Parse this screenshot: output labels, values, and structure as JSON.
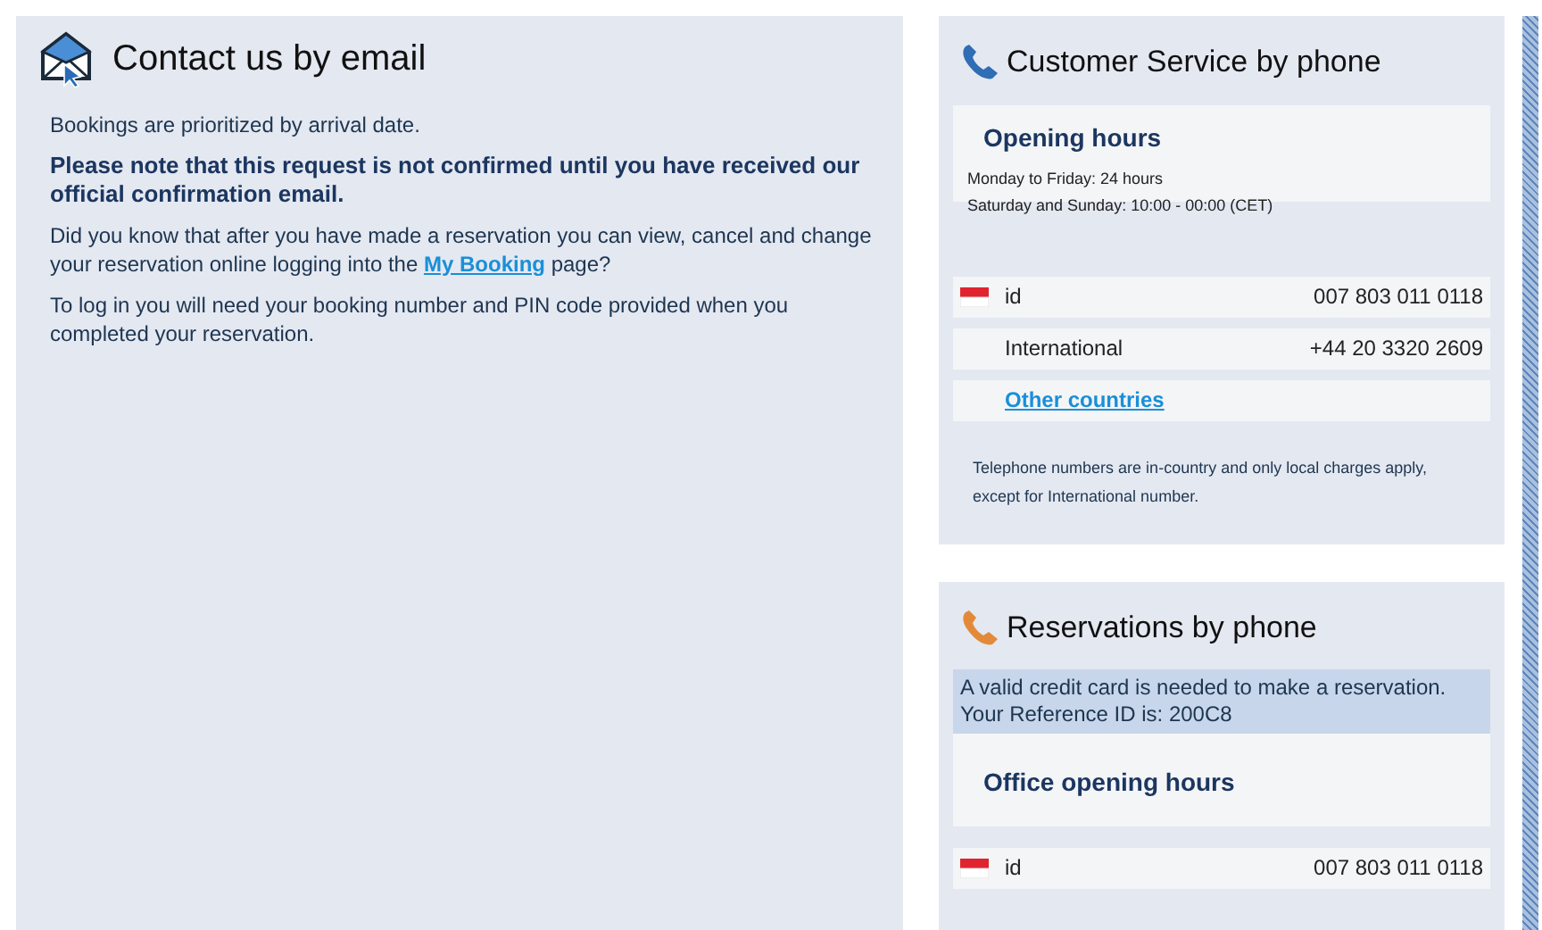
{
  "email": {
    "title": "Contact us by email",
    "paragraphs": [
      {
        "kind": "plain",
        "text": "Bookings are prioritized by arrival date."
      },
      {
        "kind": "note",
        "text": "Please note that this request is not confirmed until you have received our official confirmation email."
      },
      {
        "kind": "with_link",
        "text": "Did you know that after you have made a reservation you can view, cancel and change your reservation online logging into the",
        "link": "My Booking",
        "after": "page?"
      },
      {
        "kind": "plain",
        "text": "To log in you will need your booking number and PIN code provided when you completed your reservation."
      }
    ]
  },
  "customer_service": {
    "title": "Customer Service by phone",
    "hours": {
      "heading": "Opening hours",
      "lines": [
        "Monday to Friday: 24 hours",
        "Saturday and Sunday: 10:00 - 00:00 (CET)"
      ]
    },
    "numbers": [
      {
        "kind": "country",
        "label": "id",
        "number": "007 803 011 0118"
      },
      {
        "kind": "plain",
        "label": "International",
        "number": "+44 20 3320 2609"
      },
      {
        "kind": "link",
        "label": "Other countries"
      }
    ],
    "footnote": "Telephone numbers are in-country and only local charges apply, except for International number."
  },
  "reservations": {
    "title": "Reservations by phone",
    "notice": "A valid credit card is needed to make a reservation. Your Reference ID is: 200C8",
    "hours": {
      "heading": "Office opening hours"
    },
    "numbers": [
      {
        "kind": "country",
        "label": "id",
        "number": "007 803 011 0118"
      }
    ]
  }
}
